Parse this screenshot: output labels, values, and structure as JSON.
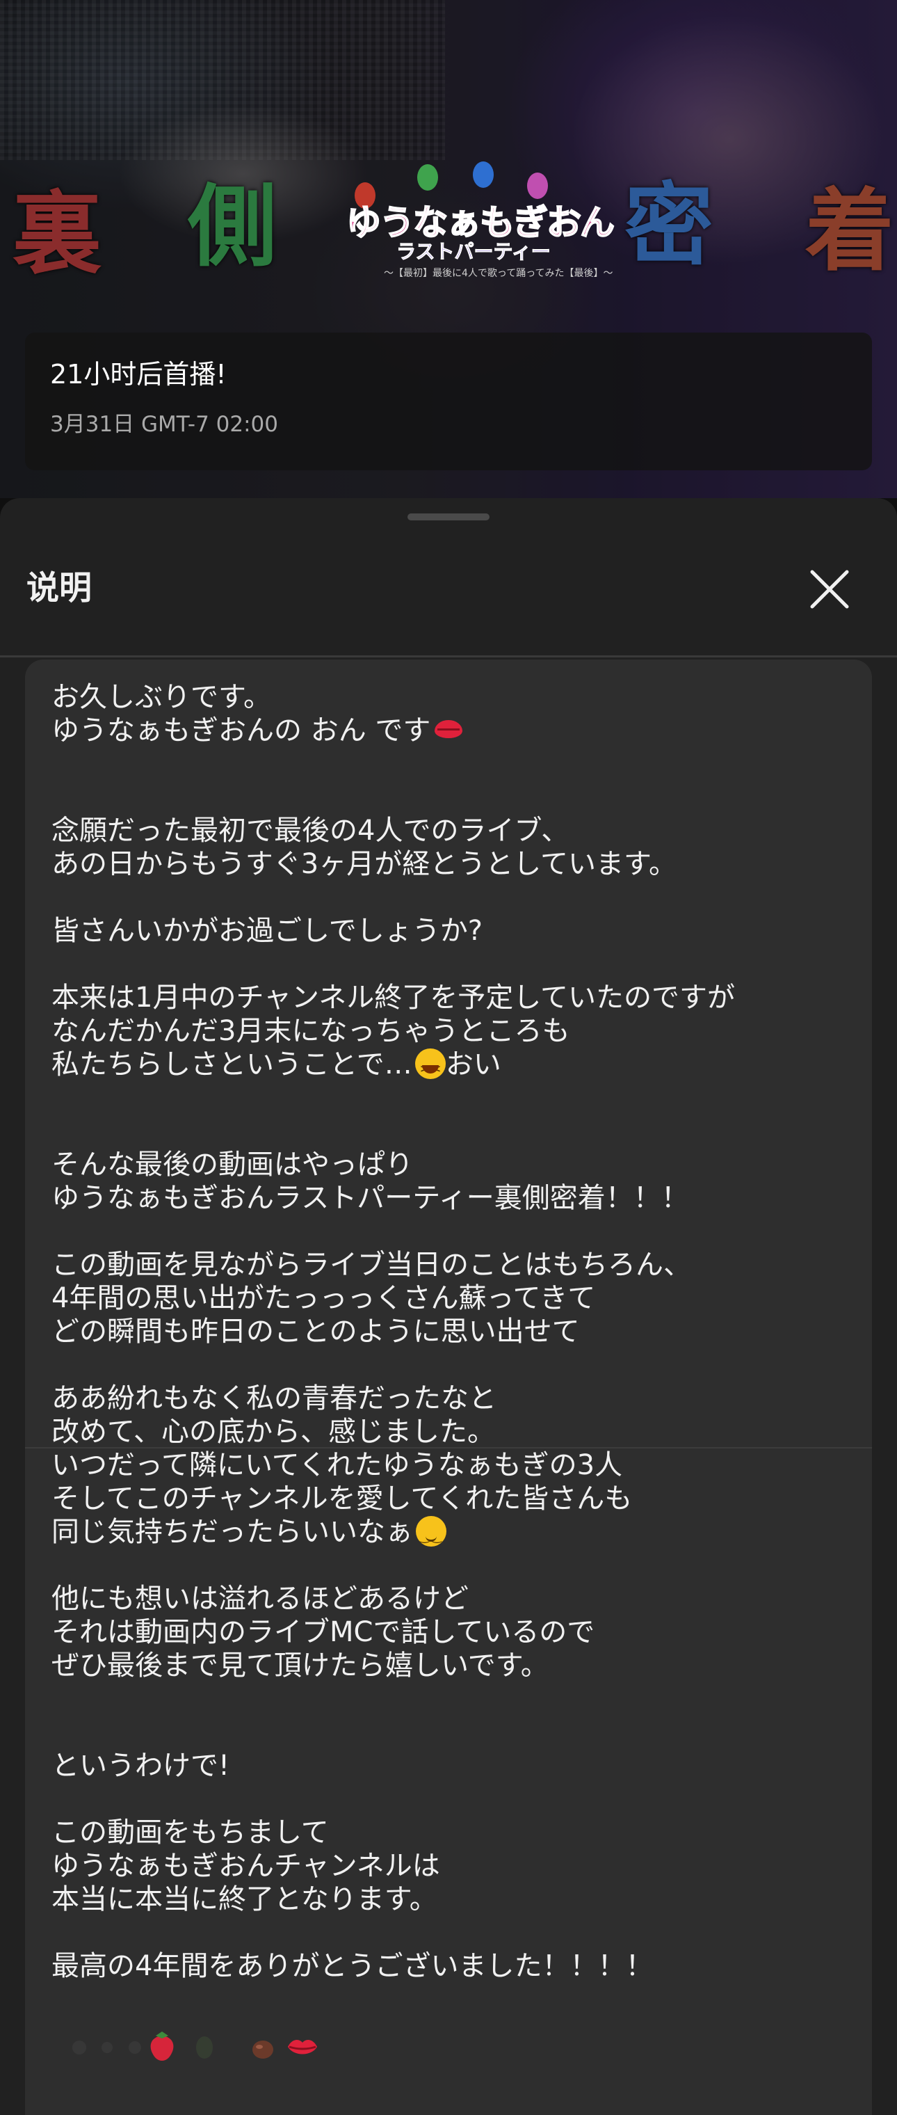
{
  "premiere": {
    "status": "21小时后首播!",
    "datetime": "3月31日 GMT-7 02:00"
  },
  "thumbnail": {
    "chars": [
      "裏",
      "側",
      "密",
      "着"
    ],
    "logo_title": "ゆうなぁもぎおん",
    "logo_subtitle": "ラストパーティー",
    "logo_caption": "〜【最初】最後に4人で歌って踊ってみた【最後】〜"
  },
  "sheet": {
    "title": "说明",
    "close_icon": "close-icon"
  },
  "description": {
    "lines": [
      "お久しぶりです。",
      "ゆうなぁもぎおんの おん です",
      "",
      "",
      "念願だった最初で最後の4人でのライブ、",
      "あの日からもうすぐ3ヶ月が経とうとしています。",
      "",
      "皆さんいかがお過ごしでしょうか?",
      "",
      "本来は1月中のチャンネル終了を予定していたのですが",
      "なんだかんだ3月末になっちゃうところも",
      "私たちらしさということで…",
      "",
      "",
      "そんな最後の動画はやっぱり",
      "ゆうなぁもぎおんラストパーティー裏側密着！！！",
      "",
      "この動画を見ながらライブ当日のことはもちろん、",
      "4年間の思い出がたっっっくさん蘇ってきて",
      "どの瞬間も昨日のことのように思い出せて",
      "",
      "ああ紛れもなく私の青春だったなと",
      "改めて、心の底から、感じました。",
      "いつだって隣にいてくれたゆうなぁもぎの3人",
      "そしてこのチャンネルを愛してくれた皆さんも",
      "同じ気持ちだったらいいなぁ",
      "",
      "他にも想いは溢れるほどあるけど",
      "それは動画内のライブMCで話しているので",
      "ぜひ最後まで見て頂けたら嬉しいです。",
      "",
      "",
      "というわけで!",
      "",
      "この動画をもちまして",
      "ゆうなぁもぎおんチャンネルは",
      "本当に本当に終了となります。",
      "",
      "最高の4年間をありがとうございました！！！！"
    ],
    "suffix_after_grin": "おい",
    "emojis": {
      "line2": "kiss-mark-icon",
      "line12": "grinning-squinting-icon",
      "line26": "relieved-face-icon"
    },
    "bottom_emojis": [
      "strawberry-icon",
      "chestnut-icon",
      "kiss-mark-icon"
    ]
  },
  "colors": {
    "background": "#0f0f0f",
    "sheet": "#212121",
    "card": "#2e2e2e",
    "text": "#f1f1f1",
    "secondary_text": "#aaaaaa"
  }
}
